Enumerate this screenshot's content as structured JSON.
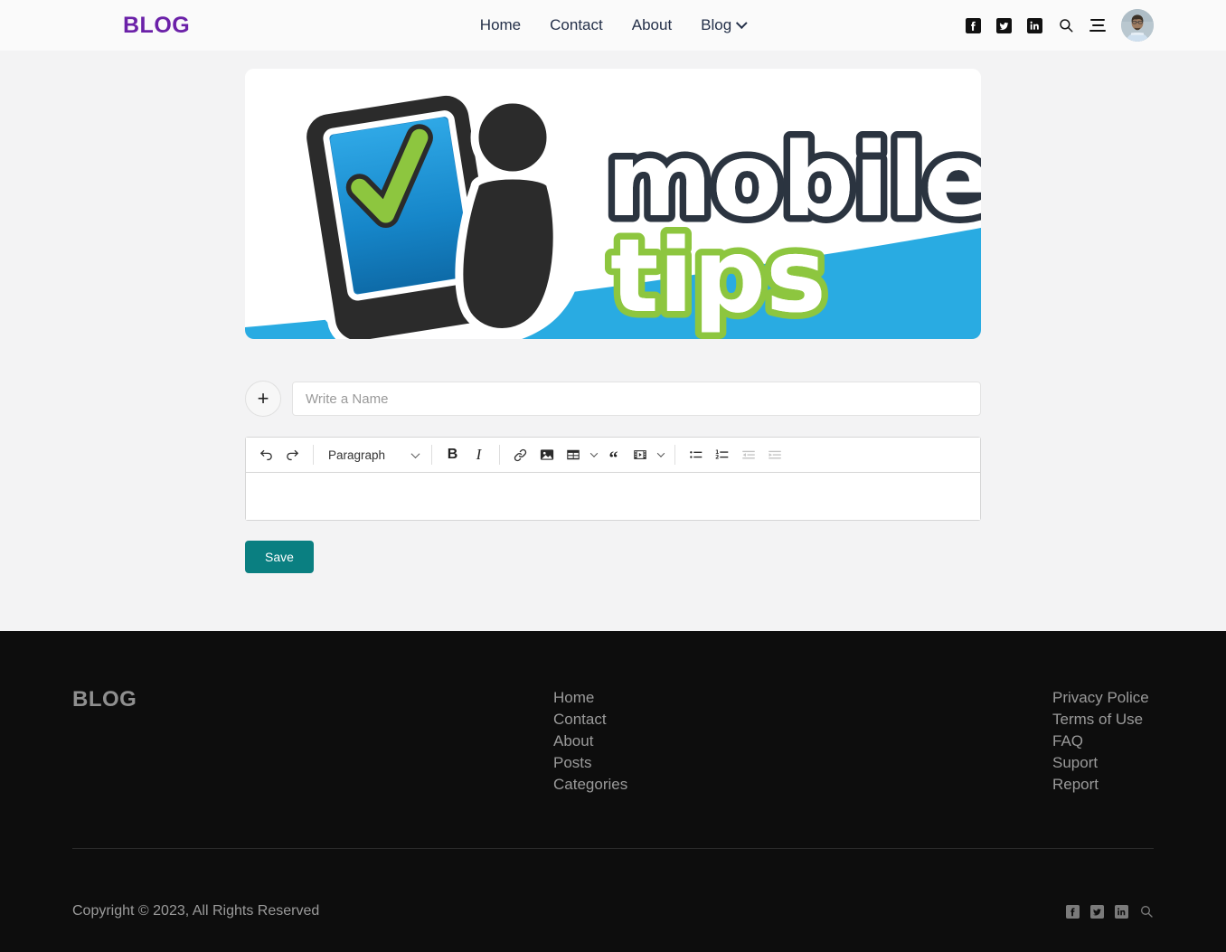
{
  "header": {
    "brand": "BLOG",
    "nav": [
      {
        "label": "Home",
        "icon": null
      },
      {
        "label": "Contact",
        "icon": null
      },
      {
        "label": "About",
        "icon": null
      },
      {
        "label": "Blog",
        "icon": "chevron-down-icon"
      }
    ],
    "icons": [
      "facebook-icon",
      "twitter-icon",
      "linkedin-icon",
      "search-icon",
      "menu-icon"
    ],
    "avatar_alt": "user-avatar"
  },
  "hero": {
    "alt": "mobile tips banner",
    "word_top": "mobile",
    "word_bottom": "tips",
    "colors": {
      "navy": "#2b3440",
      "green": "#8dc63f",
      "blue": "#29abe2"
    }
  },
  "editor": {
    "add_button_label": "+",
    "name_placeholder": "Write a Name",
    "name_value": "",
    "toolbar": {
      "undo_label": "undo-icon",
      "redo_label": "redo-icon",
      "block_format": "Paragraph",
      "bold_label": "B",
      "italic_label": "I",
      "link_label": "link-icon",
      "image_label": "image-icon",
      "table_label": "table-icon",
      "quote_label": "“",
      "media_label": "media-icon",
      "bullet_list_label": "bullet-list-icon",
      "numbered_list_label": "numbered-list-icon",
      "outdent_label": "outdent-icon",
      "indent_label": "indent-icon"
    },
    "body_text": "",
    "save_label": "Save",
    "save_color": "#0a7f81"
  },
  "footer": {
    "brand": "BLOG",
    "links_mid": [
      "Home",
      "Contact",
      "About",
      "Posts",
      "Categories"
    ],
    "links_right": [
      "Privacy Police",
      "Terms of Use",
      "FAQ",
      "Suport",
      "Report"
    ],
    "copyright": "Copyright © 2023, All Rights Reserved",
    "icons": [
      "facebook-icon",
      "twitter-icon",
      "linkedin-icon",
      "search-icon"
    ]
  }
}
